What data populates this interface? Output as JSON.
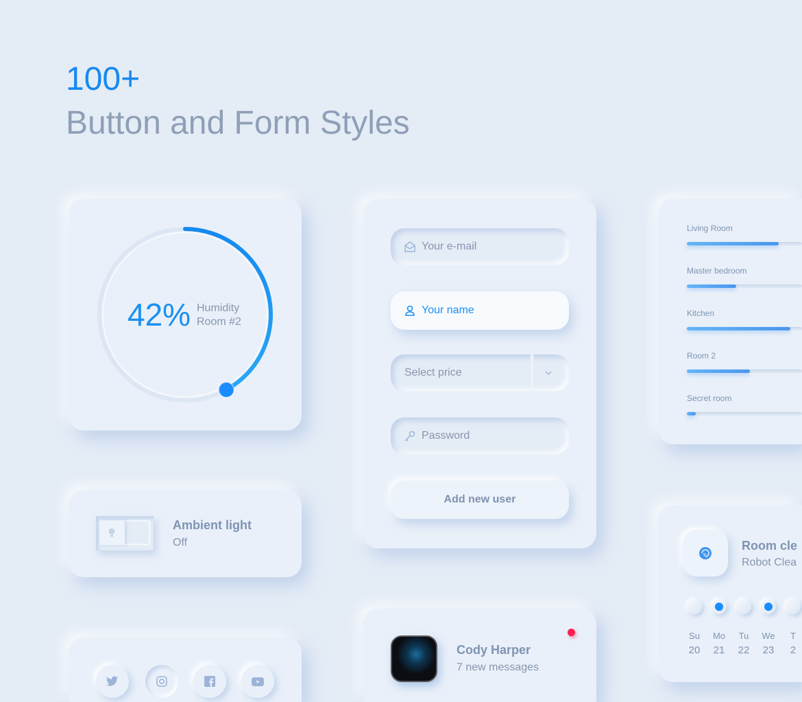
{
  "header": {
    "count": "100+",
    "subtitle": "Button and Form Styles"
  },
  "colors": {
    "accent": "#1689f0",
    "background": "#e4ecf6",
    "notification": "#ff1f4f"
  },
  "humidity": {
    "value": "42%",
    "fraction": 0.42,
    "label1": "Humidity",
    "label2": "Room #2"
  },
  "form": {
    "email_placeholder": "Your e-mail",
    "name_value": "Your name",
    "price_placeholder": "Select price",
    "password_placeholder": "Password",
    "submit_label": "Add new user"
  },
  "rooms": [
    {
      "label": "Living Room",
      "level": 0.8
    },
    {
      "label": "Master bedroom",
      "level": 0.43
    },
    {
      "label": "Kitchen",
      "level": 0.9
    },
    {
      "label": "Room 2",
      "level": 0.55
    },
    {
      "label": "Secret room",
      "level": 0.08
    }
  ],
  "ambient": {
    "title": "Ambient light",
    "status": "Off",
    "on": false
  },
  "profile": {
    "name": "Cody Harper",
    "messages": "7 new messages",
    "online_indicator": true
  },
  "cleaner": {
    "title": "Room cle",
    "subtitle": "Robot Clea",
    "days": [
      {
        "d": "Su",
        "n": "20",
        "on": false
      },
      {
        "d": "Mo",
        "n": "21",
        "on": true
      },
      {
        "d": "Tu",
        "n": "22",
        "on": false
      },
      {
        "d": "We",
        "n": "23",
        "on": true
      },
      {
        "d": "T",
        "n": "2",
        "on": false
      }
    ]
  },
  "social": [
    "twitter-icon",
    "instagram-icon",
    "facebook-icon",
    "youtube-icon"
  ]
}
